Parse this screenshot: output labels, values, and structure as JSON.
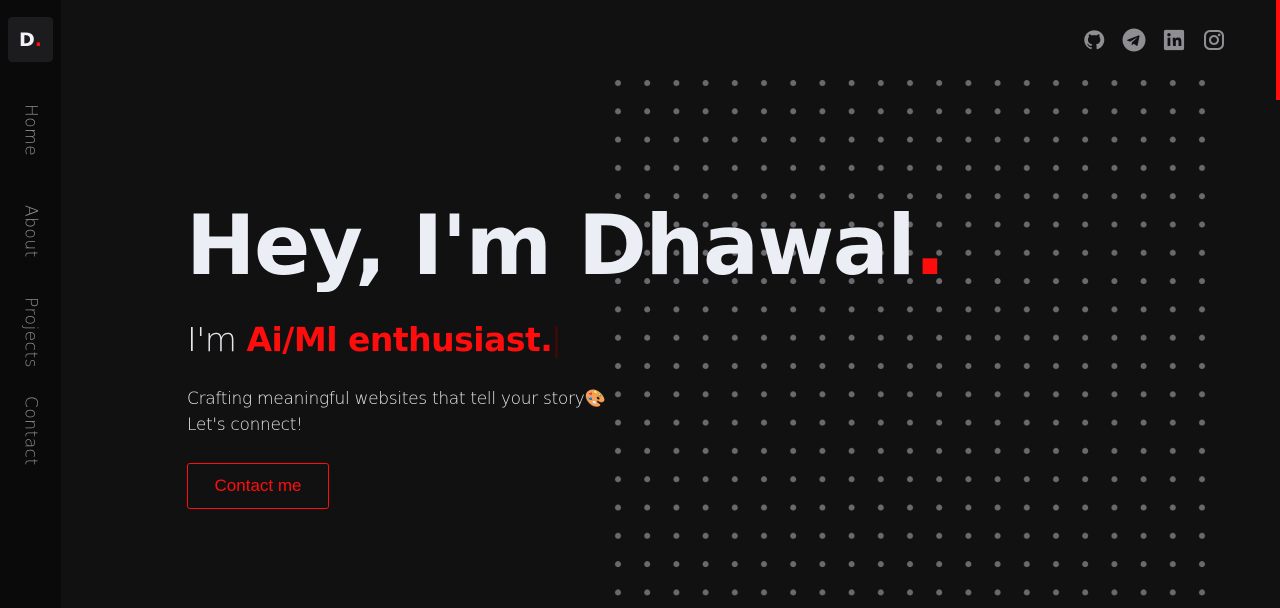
{
  "logo": {
    "letter": "D",
    "dot": "."
  },
  "nav": {
    "items": [
      {
        "label": "Home"
      },
      {
        "label": "About"
      },
      {
        "label": "Projects"
      },
      {
        "label": "Contact"
      }
    ]
  },
  "socials": [
    "github-icon",
    "telegram-icon",
    "linkedin-icon",
    "instagram-icon"
  ],
  "hero": {
    "title": "Hey, I'm Dhawal",
    "title_dot": ".",
    "subtitle_prefix": "I'm ",
    "role": "Ai/Ml enthusiast.",
    "tagline_line1": "Crafting meaningful websites that tell your story",
    "tagline_emoji": "🎨",
    "tagline_line2": "Let's connect!",
    "cta_label": "Contact me"
  },
  "colors": {
    "background": "#111112",
    "sidebar": "#0a0a0a",
    "accent": "#ff0d0d",
    "text": "#eceef5",
    "muted": "#8e8e93"
  }
}
